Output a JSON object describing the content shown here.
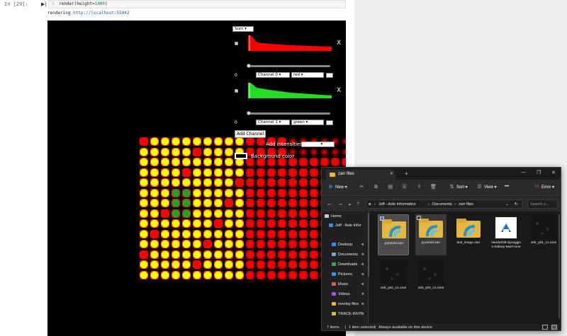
{
  "notebook": {
    "prompt": "In [29]:",
    "line_number": "1",
    "code_prefix": "render(height=",
    "code_number": "1000",
    "code_suffix": ")",
    "output_prefix": "rendering ",
    "output_link": "http://localhost:55942"
  },
  "viewer": {
    "aggregation_value": "Sum",
    "channels": [
      {
        "value": "0",
        "channel": "Channel 0",
        "color": "red",
        "hist_color": "#ff0000",
        "checked": "✔",
        "close": "X"
      },
      {
        "value": "0",
        "channel": "Channel 1",
        "color": "green",
        "hist_color": "#22dd22",
        "checked": "✔",
        "close": "X"
      }
    ],
    "add_channel_label": "Add Channel",
    "add_intensities_label": "Add intensities",
    "background_label": "Background color",
    "colors": {
      "yellow": "#ffff00",
      "red": "#ff0000",
      "green": "#1ea51e"
    }
  },
  "explorer": {
    "tab_title": "zarr files",
    "toolbar": {
      "new_label": "New",
      "sort_label": "Sort",
      "view_label": "View",
      "more_label": "•••",
      "error_label": "Error"
    },
    "breadcrumbs": [
      "Jeff - Axle Informatics",
      "Documents",
      "zarr files"
    ],
    "search_placeholder": "Search z...",
    "sidebar": [
      {
        "label": "Home",
        "icon": "home-icon",
        "color": "#cccccc",
        "pin": ""
      },
      {
        "label": "Jeff - Axle Infor",
        "icon": "cloud-icon",
        "color": "#3a8ee6",
        "pin": ""
      },
      {
        "label": "Desktop",
        "icon": "desktop-icon",
        "color": "#3a8ee6",
        "pin": "✱"
      },
      {
        "label": "Documents",
        "icon": "documents-icon",
        "color": "#8aa0c0",
        "pin": "✱"
      },
      {
        "label": "Downloads",
        "icon": "downloads-icon",
        "color": "#2fa84f",
        "pin": "✱"
      },
      {
        "label": "Pictures",
        "icon": "pictures-icon",
        "color": "#3a8ee6",
        "pin": "✱"
      },
      {
        "label": "Music",
        "icon": "music-icon",
        "color": "#e05a5a",
        "pin": "✱"
      },
      {
        "label": "Videos",
        "icon": "videos-icon",
        "color": "#9a5ae0",
        "pin": "✱"
      },
      {
        "label": "overlay files",
        "icon": "folder-icon",
        "color": "#e7b742",
        "pin": "✱"
      },
      {
        "label": "TRACE-INVIT",
        "icon": "folder-icon",
        "color": "#e7b742",
        "pin": "✱"
      }
    ],
    "files": [
      {
        "name": "pyramid.zarr",
        "type": "folder"
      },
      {
        "name": "pyramid.zarr",
        "type": "folder"
      },
      {
        "name": "test_image.zarr",
        "type": "folder"
      },
      {
        "name": "Vanderbilt-Spraggins-Kidney-MxIF.ome",
        "type": "doc"
      },
      {
        "name": "x00_y01_c1.ome",
        "type": "dark"
      },
      {
        "name": "x00_y02_c1.ome",
        "type": "dark"
      },
      {
        "name": "x00_y03_c1.ome",
        "type": "dark"
      }
    ],
    "status": {
      "count": "7 items",
      "selected": "1 item selected",
      "availability": "Always available on this device"
    }
  }
}
